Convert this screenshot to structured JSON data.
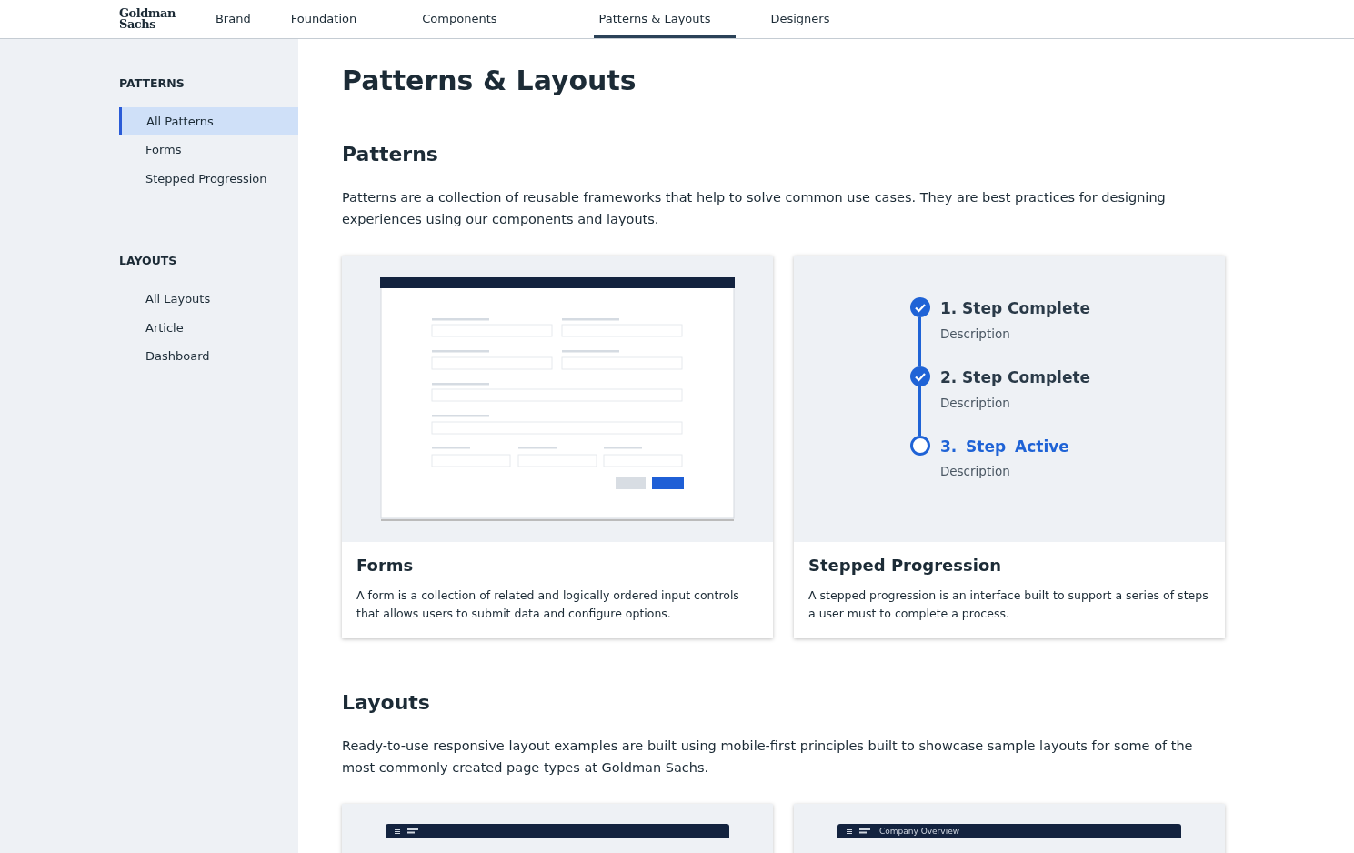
{
  "header": {
    "logo": [
      "Goldman",
      "Sachs"
    ],
    "nav": [
      {
        "label": "Brand",
        "selected": false
      },
      {
        "label": "Foundation",
        "selected": false
      },
      {
        "label": "Components",
        "selected": false
      },
      {
        "label": "Patterns & Layouts",
        "selected": true
      },
      {
        "label": "Designers",
        "selected": false
      }
    ]
  },
  "sidebar": {
    "sections": [
      {
        "title": "PATTERNS",
        "items": [
          {
            "label": "All Patterns",
            "selected": true
          },
          {
            "label": "Forms",
            "selected": false
          },
          {
            "label": "Stepped Progression",
            "selected": false
          }
        ]
      },
      {
        "title": "LAYOUTS",
        "items": [
          {
            "label": "All Layouts",
            "selected": false
          },
          {
            "label": "Article",
            "selected": false
          },
          {
            "label": "Dashboard",
            "selected": false
          }
        ]
      }
    ]
  },
  "page_title": "Patterns & Layouts",
  "sections": [
    {
      "heading": "Patterns",
      "description": "Patterns are a collection of reusable frameworks that help to solve common use cases. They are best practices for designing experiences using our components and layouts.",
      "cards": [
        {
          "kind": "form",
          "title": "Forms",
          "description": "A form is a collection of related and logically ordered input controls that allows users to submit data and configure options."
        },
        {
          "kind": "steps",
          "title": "Stepped Progression",
          "description": "A stepped progression is an interface built to support a series of steps a user must to complete a process.",
          "steps": [
            {
              "number": "1.",
              "label": "Step Complete",
              "description": "Description",
              "completed": true
            },
            {
              "number": "2.",
              "label": "Step Complete",
              "description": "Description",
              "completed": true
            },
            {
              "number": "3.",
              "label": "Step Active",
              "description": "Description",
              "completed": false
            }
          ]
        }
      ]
    },
    {
      "heading": "Layouts",
      "description": "Ready-to-use responsive layout examples are built using mobile-first principles built to showcase sample layouts for some of the most commonly created page types at Goldman Sachs.",
      "cards": [
        {
          "kind": "layout"
        },
        {
          "kind": "layout",
          "bar_title": "Company Overview"
        }
      ]
    }
  ]
}
